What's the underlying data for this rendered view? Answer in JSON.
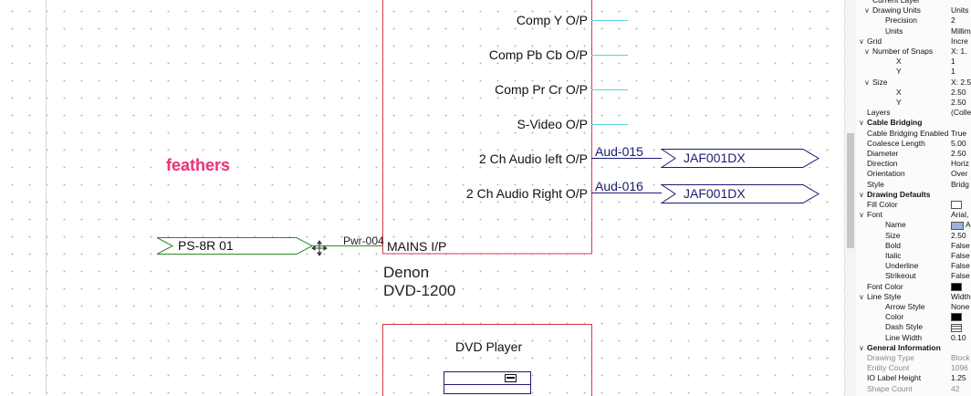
{
  "canvas": {
    "annotation": "feathers",
    "device": {
      "name_line1": "Denon",
      "name_line2": "DVD-1200",
      "outputs": [
        {
          "label": "Comp Y O/P"
        },
        {
          "label": "Comp Pb Cb  O/P"
        },
        {
          "label": "Comp Pr Cr O/P"
        },
        {
          "label": "S-Video O/P"
        },
        {
          "label": "2 Ch Audio left O/P",
          "cable": "Aud-015",
          "destination": "JAF001DX"
        },
        {
          "label": "2 Ch Audio Right O/P",
          "cable": "Aud-016",
          "destination": "JAF001DX"
        }
      ],
      "input": {
        "label": "MAINS I/P",
        "cable": "Pwr-004",
        "source": "PS-8R 01"
      }
    },
    "device2": {
      "title": "DVD Player"
    }
  },
  "properties": {
    "rows": [
      {
        "key": "Current Layer",
        "value": "",
        "indent": 1,
        "type": "prop"
      },
      {
        "key": "Drawing Units",
        "value": "Units",
        "indent": 1,
        "type": "group",
        "expanded": true
      },
      {
        "key": "Precision",
        "value": "2",
        "indent": 2,
        "type": "prop"
      },
      {
        "key": "Units",
        "value": "Millim",
        "indent": 2,
        "type": "prop"
      },
      {
        "key": "Grid",
        "value": "Incre",
        "indent": 0,
        "type": "group",
        "expanded": true
      },
      {
        "key": "Number of Snaps",
        "value": "X: 1.",
        "indent": 1,
        "type": "group",
        "expanded": true
      },
      {
        "key": "X",
        "value": "1",
        "indent": 3,
        "type": "prop"
      },
      {
        "key": "Y",
        "value": "1",
        "indent": 3,
        "type": "prop"
      },
      {
        "key": "Size",
        "value": "X: 2.5",
        "indent": 1,
        "type": "group",
        "expanded": true
      },
      {
        "key": "X",
        "value": "2.50",
        "indent": 3,
        "type": "prop"
      },
      {
        "key": "Y",
        "value": "2.50",
        "indent": 3,
        "type": "prop"
      },
      {
        "key": "Layers",
        "value": "(Collec",
        "indent": 0,
        "type": "prop"
      },
      {
        "key": "Cable Bridging",
        "value": "",
        "indent": 0,
        "type": "category",
        "expanded": true
      },
      {
        "key": "Cable Bridging Enabled",
        "value": "True",
        "indent": 0,
        "type": "prop"
      },
      {
        "key": "Coalesce Length",
        "value": "5.00",
        "indent": 0,
        "type": "prop"
      },
      {
        "key": "Diameter",
        "value": "2.50",
        "indent": 0,
        "type": "prop"
      },
      {
        "key": "Direction",
        "value": "Horiz",
        "indent": 0,
        "type": "prop"
      },
      {
        "key": "Orientation",
        "value": "Over",
        "indent": 0,
        "type": "prop"
      },
      {
        "key": "Style",
        "value": "Bridg",
        "indent": 0,
        "type": "prop"
      },
      {
        "key": "Drawing Defaults",
        "value": "",
        "indent": 0,
        "type": "category",
        "expanded": true
      },
      {
        "key": "Fill Color",
        "value": "",
        "swatch": "white",
        "indent": 0,
        "type": "prop"
      },
      {
        "key": "Font",
        "value": "Arial,",
        "indent": 0,
        "type": "group",
        "expanded": true
      },
      {
        "key": "Name",
        "value": "A",
        "swatch": "ab",
        "indent": 2,
        "type": "prop"
      },
      {
        "key": "Size",
        "value": "2.50",
        "indent": 2,
        "type": "prop"
      },
      {
        "key": "Bold",
        "value": "False",
        "indent": 2,
        "type": "prop"
      },
      {
        "key": "Italic",
        "value": "False",
        "indent": 2,
        "type": "prop"
      },
      {
        "key": "Underline",
        "value": "False",
        "indent": 2,
        "type": "prop"
      },
      {
        "key": "Strikeout",
        "value": "False",
        "indent": 2,
        "type": "prop"
      },
      {
        "key": "Font Color",
        "value": "",
        "swatch": "black",
        "indent": 0,
        "type": "prop"
      },
      {
        "key": "Line Style",
        "value": "Width",
        "indent": 0,
        "type": "group",
        "expanded": true
      },
      {
        "key": "Arrow Style",
        "value": "None",
        "indent": 2,
        "type": "prop"
      },
      {
        "key": "Color",
        "value": "",
        "swatch": "black",
        "indent": 2,
        "type": "prop"
      },
      {
        "key": "Dash Style",
        "value": "",
        "swatch": "dash",
        "indent": 2,
        "type": "prop"
      },
      {
        "key": "Line Width",
        "value": "0.10",
        "indent": 2,
        "type": "prop"
      },
      {
        "key": "General Information",
        "value": "",
        "indent": 0,
        "type": "category",
        "expanded": true
      },
      {
        "key": "Drawing Type",
        "value": "Block",
        "indent": 0,
        "type": "readonly"
      },
      {
        "key": "Entity Count",
        "value": "1096",
        "indent": 0,
        "type": "readonly"
      },
      {
        "key": "IO Label Height",
        "value": "1.25",
        "indent": 0,
        "type": "prop"
      },
      {
        "key": "Shape Count",
        "value": "42",
        "indent": 0,
        "type": "readonly"
      }
    ]
  },
  "colors": {
    "device_border": "#d9394a",
    "cable_blue": "#1b1b72",
    "stub_cyan": "#5ad0e6",
    "power_green": "#2c8a2c",
    "annotation_pink": "#e8367a"
  }
}
